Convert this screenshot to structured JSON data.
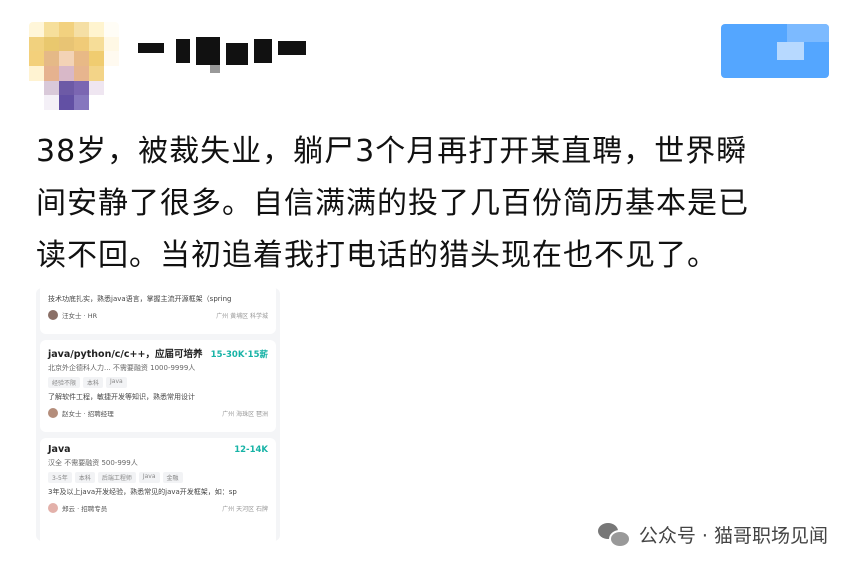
{
  "post": {
    "lines": [
      "38岁，被裁失业，躺尸3个月再打开某直聘，世界瞬",
      "间安静了很多。自信满满的投了几百份简历基本是已",
      "读不回。当初追着我打电话的猎头现在也不见了。"
    ]
  },
  "jobs": [
    {
      "description": "技术功底扎实，熟悉java语言，掌握主流开源框架（spring",
      "recruiter": "汪女士 · HR",
      "location": "广州  黄埔区  科学城"
    },
    {
      "title": "java/python/c/c++，应届可培养",
      "salary": "15-30K·15薪",
      "company": "北京外企德科人力...  不需要融资  1000-9999人",
      "tags": [
        "经验不限",
        "本科",
        "Java"
      ],
      "description": "了解软件工程，敏捷开发等知识，熟悉常用设计",
      "recruiter": "赵女士 · 招聘经理",
      "location": "广州  海珠区  琶洲"
    },
    {
      "title": "Java",
      "salary": "12-14K",
      "company": "汉全  不需要融资  500-999人",
      "tags": [
        "3-5年",
        "本科",
        "后端工程师",
        "Java",
        "金融"
      ],
      "description": "3年及以上java开发经验，熟悉常见的java开发框架，如：sp",
      "recruiter": "郑云 · 招聘专员",
      "location": "广州  天河区  石牌"
    }
  ],
  "watermark": {
    "icon": "wechat-icon",
    "text": "公众号 · 猫哥职场见闻"
  },
  "colors": {
    "salary": "#17b3a6",
    "follow_button": "#54a6ff",
    "text": "#111111"
  }
}
